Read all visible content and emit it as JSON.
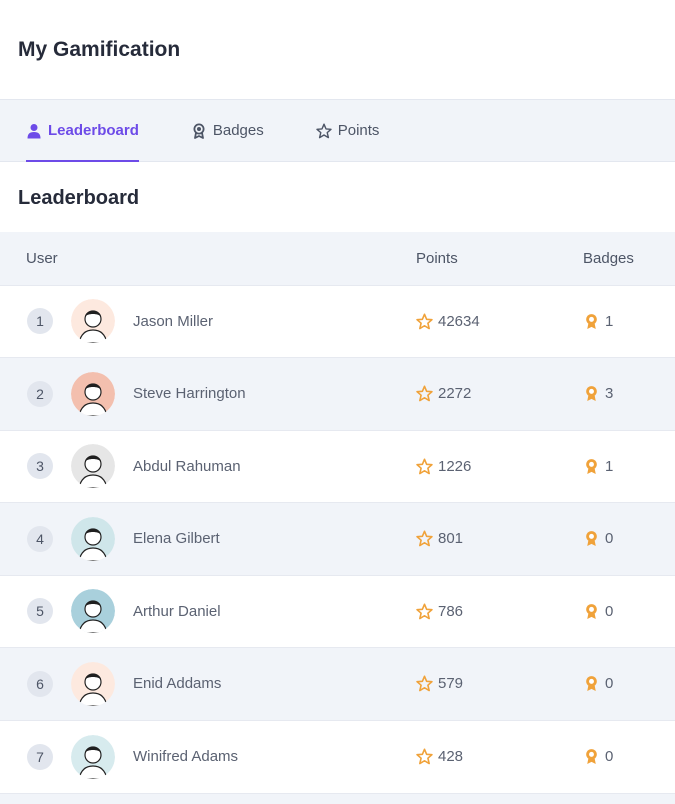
{
  "header": {
    "title": "My Gamification"
  },
  "tabs": [
    {
      "label": "Leaderboard",
      "icon": "user-icon",
      "active": true
    },
    {
      "label": "Badges",
      "icon": "award-icon",
      "active": false
    },
    {
      "label": "Points",
      "icon": "star-icon",
      "active": false
    }
  ],
  "section": {
    "title": "Leaderboard"
  },
  "table": {
    "columns": [
      "User",
      "Points",
      "Badges"
    ],
    "rows": [
      {
        "rank": "1",
        "name": "Jason Miller",
        "points": "42634",
        "badges": "1",
        "avatar_bg": "#fde9df"
      },
      {
        "rank": "2",
        "name": "Steve Harrington",
        "points": "2272",
        "badges": "3",
        "avatar_bg": "#f3bfae"
      },
      {
        "rank": "3",
        "name": "Abdul Rahuman",
        "points": "1226",
        "badges": "1",
        "avatar_bg": "#e6e6e6"
      },
      {
        "rank": "4",
        "name": "Elena Gilbert",
        "points": "801",
        "badges": "0",
        "avatar_bg": "#cfe6ea"
      },
      {
        "rank": "5",
        "name": "Arthur Daniel",
        "points": "786",
        "badges": "0",
        "avatar_bg": "#a9d0dc"
      },
      {
        "rank": "6",
        "name": "Enid Addams",
        "points": "579",
        "badges": "0",
        "avatar_bg": "#fde9df"
      },
      {
        "rank": "7",
        "name": "Winifred Adams",
        "points": "428",
        "badges": "0",
        "avatar_bg": "#d7ebee"
      }
    ]
  },
  "colors": {
    "accent": "#6d4be8",
    "star": "#f0a23a",
    "badge": "#f0a23a"
  }
}
